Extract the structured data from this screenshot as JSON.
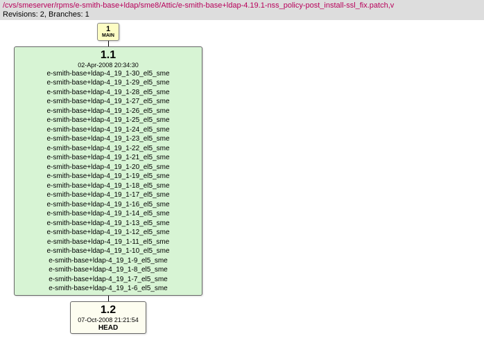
{
  "header": {
    "path": "/cvs/smeserver/rpms/e-smith-base+ldap/sme8/Attic/e-smith-base+ldap-4.19.1-nss_policy-post_install-ssl_fix.patch,v",
    "revisions_line": "Revisions: 2, Branches: 1"
  },
  "branch_node": {
    "number": "1",
    "name": "MAIN"
  },
  "rev1": {
    "number": "1.1",
    "date": "02-Apr-2008 20:34:30",
    "tags": [
      "e-smith-base+ldap-4_19_1-30_el5_sme",
      "e-smith-base+ldap-4_19_1-29_el5_sme",
      "e-smith-base+ldap-4_19_1-28_el5_sme",
      "e-smith-base+ldap-4_19_1-27_el5_sme",
      "e-smith-base+ldap-4_19_1-26_el5_sme",
      "e-smith-base+ldap-4_19_1-25_el5_sme",
      "e-smith-base+ldap-4_19_1-24_el5_sme",
      "e-smith-base+ldap-4_19_1-23_el5_sme",
      "e-smith-base+ldap-4_19_1-22_el5_sme",
      "e-smith-base+ldap-4_19_1-21_el5_sme",
      "e-smith-base+ldap-4_19_1-20_el5_sme",
      "e-smith-base+ldap-4_19_1-19_el5_sme",
      "e-smith-base+ldap-4_19_1-18_el5_sme",
      "e-smith-base+ldap-4_19_1-17_el5_sme",
      "e-smith-base+ldap-4_19_1-16_el5_sme",
      "e-smith-base+ldap-4_19_1-14_el5_sme",
      "e-smith-base+ldap-4_19_1-13_el5_sme",
      "e-smith-base+ldap-4_19_1-12_el5_sme",
      "e-smith-base+ldap-4_19_1-11_el5_sme",
      "e-smith-base+ldap-4_19_1-10_el5_sme",
      "e-smith-base+ldap-4_19_1-9_el5_sme",
      "e-smith-base+ldap-4_19_1-8_el5_sme",
      "e-smith-base+ldap-4_19_1-7_el5_sme",
      "e-smith-base+ldap-4_19_1-6_el5_sme"
    ]
  },
  "rev2": {
    "number": "1.2",
    "date": "07-Oct-2008 21:21:54",
    "head": "HEAD"
  }
}
